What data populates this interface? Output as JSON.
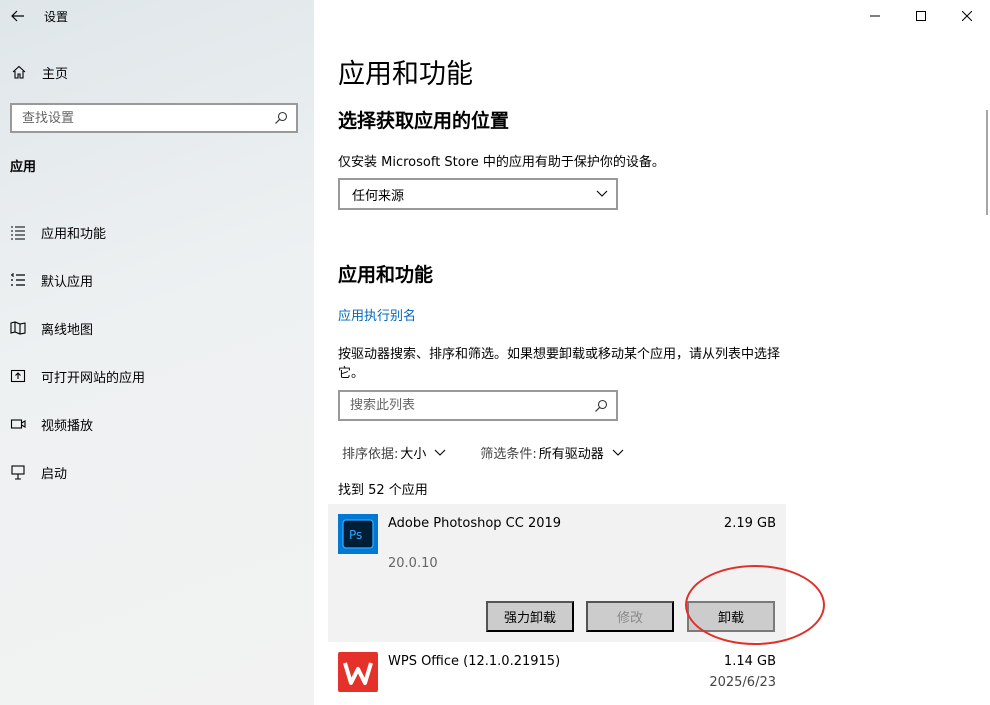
{
  "window": {
    "title": "设置"
  },
  "sidebar": {
    "home_label": "主页",
    "search_placeholder": "查找设置",
    "section_label": "应用",
    "items": [
      {
        "label": "应用和功能",
        "icon": "list-icon"
      },
      {
        "label": "默认应用",
        "icon": "default-apps-icon"
      },
      {
        "label": "离线地图",
        "icon": "map-icon"
      },
      {
        "label": "可打开网站的应用",
        "icon": "open-website-icon"
      },
      {
        "label": "视频播放",
        "icon": "video-icon"
      },
      {
        "label": "启动",
        "icon": "startup-icon"
      }
    ]
  },
  "main": {
    "page_title": "应用和功能",
    "choose_heading": "选择获取应用的位置",
    "store_note": "仅安装 Microsoft Store 中的应用有助于保护你的设备。",
    "source_select_value": "任何来源",
    "apps_heading": "应用和功能",
    "alias_link": "应用执行别名",
    "description": "按驱动器搜索、排序和筛选。如果想要卸载或移动某个应用，请从列表中选择它。",
    "list_search_placeholder": "搜索此列表",
    "sort": {
      "label": "排序依据:",
      "value": "大小"
    },
    "filter": {
      "label": "筛选条件:",
      "value": "所有驱动器"
    },
    "found_count": "找到 52 个应用",
    "apps": [
      {
        "name": "Adobe Photoshop CC 2019",
        "size": "2.19 GB",
        "version": "20.0.10",
        "icon_text": "Ps",
        "buttons": {
          "force_uninstall": "强力卸载",
          "modify": "修改",
          "uninstall": "卸载"
        }
      },
      {
        "name": "WPS Office (12.1.0.21915)",
        "size": "1.14 GB",
        "date": "2025/6/23"
      }
    ]
  },
  "colors": {
    "accent_link": "#0067c0",
    "ps_bg": "#001e36",
    "ps_blue": "#31a8ff",
    "wps_red": "#e4322b",
    "annotation_red": "#e0302a"
  }
}
